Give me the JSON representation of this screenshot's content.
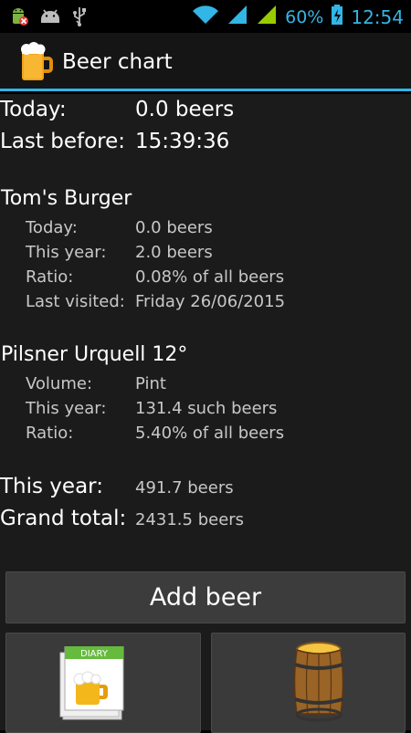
{
  "status": {
    "battery_pct": "60%",
    "time": "12:54"
  },
  "app": {
    "title": "Beer chart"
  },
  "summary": {
    "today_label": "Today:",
    "today_value": "0.0 beers",
    "last_label": "Last before:",
    "last_value": "15:39:36"
  },
  "place": {
    "name": "Tom's Burger",
    "rows": [
      {
        "label": "Today:",
        "value": "0.0 beers"
      },
      {
        "label": "This year:",
        "value": "2.0 beers"
      },
      {
        "label": "Ratio:",
        "value": "0.08% of all beers"
      },
      {
        "label": "Last visited:",
        "value": "Friday 26/06/2015"
      }
    ]
  },
  "beer": {
    "name": "Pilsner Urquell 12°",
    "rows": [
      {
        "label": "Volume:",
        "value": "Pint"
      },
      {
        "label": "This year:",
        "value": "131.4 such beers"
      },
      {
        "label": "Ratio:",
        "value": "5.40% of all beers"
      }
    ]
  },
  "totals": {
    "year_label": "This year:",
    "year_value": "491.7 beers",
    "grand_label": "Grand total:",
    "grand_value": "2431.5 beers"
  },
  "buttons": {
    "add_beer": "Add beer",
    "diary_icon_text": "DIARY"
  },
  "colors": {
    "accent": "#33b5e5",
    "signal": "#99cc00"
  }
}
